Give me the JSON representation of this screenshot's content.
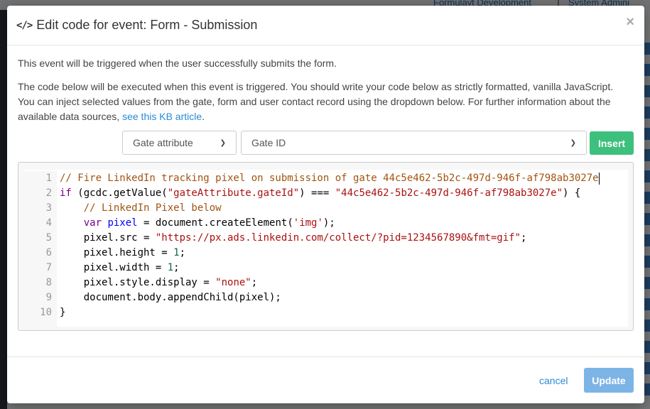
{
  "background": {
    "top_links": [
      "Formulayt Development",
      "System Admini"
    ]
  },
  "modal": {
    "title": "Edit code for event: Form - Submission",
    "close_symbol": "×",
    "intro": "This event will be triggered when the user successfully submits the form.",
    "description": "The code below will be executed when this event is triggered. You should write your code below as strictly formatted, vanilla JavaScript. You can inject selected values from the gate, form and user contact record using the dropdown below. For further information about the available data sources, ",
    "kb_link": "see this KB article",
    "description_end": "."
  },
  "controls": {
    "source_select": "Gate attribute",
    "field_select": "Gate ID",
    "insert_label": "Insert"
  },
  "editor": {
    "line_numbers": [
      "1",
      "2",
      "3",
      "4",
      "5",
      "6",
      "7",
      "8",
      "9",
      "10"
    ],
    "lines": [
      "// Fire LinkedIn tracking pixel on submission of gate 44c5e462-5b2c-497d-946f-af798ab3027e",
      "if (gcdc.getValue(\"gateAttribute.gateId\") === \"44c5e462-5b2c-497d-946f-af798ab3027e\") {",
      "    // LinkedIn Pixel below",
      "    var pixel = document.createElement('img');",
      "    pixel.src = \"https://px.ads.linkedin.com/collect/?pid=1234567890&fmt=gif\";",
      "    pixel.height = 1;",
      "    pixel.width = 1;",
      "    pixel.style.display = \"none\";",
      "    document.body.appendChild(pixel);",
      "}"
    ]
  },
  "footer": {
    "cancel_label": "cancel",
    "update_label": "Update"
  },
  "colors": {
    "insert_green": "#3ec07d",
    "update_blue": "#7db4e6",
    "link_blue": "#2a8bd6"
  }
}
